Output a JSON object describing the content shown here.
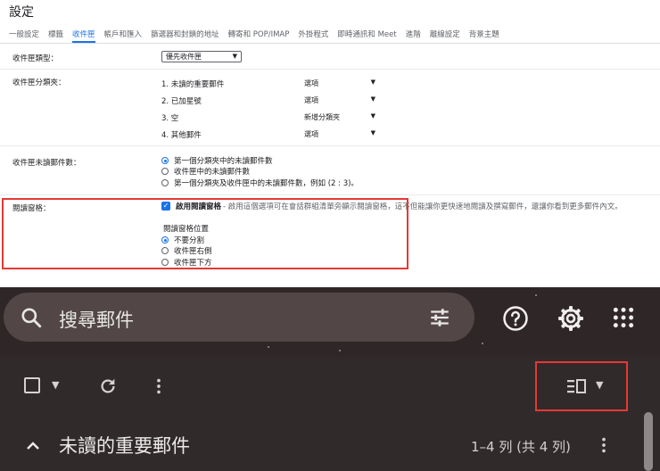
{
  "settings": {
    "title": "設定",
    "tabs": [
      {
        "label": "一般設定",
        "active": false
      },
      {
        "label": "標籤",
        "active": false
      },
      {
        "label": "收件匣",
        "active": true
      },
      {
        "label": "帳戶和匯入",
        "active": false
      },
      {
        "label": "篩選器和封鎖的地址",
        "active": false
      },
      {
        "label": "轉寄和 POP/IMAP",
        "active": false
      },
      {
        "label": "外掛程式",
        "active": false
      },
      {
        "label": "即時通訊和 Meet",
        "active": false
      },
      {
        "label": "進階",
        "active": false
      },
      {
        "label": "離線設定",
        "active": false
      },
      {
        "label": "背景主題",
        "active": false
      }
    ],
    "inbox_type": {
      "label": "收件匣類型：",
      "value": "優先收件匣"
    },
    "inbox_sections": {
      "label": "收件匣分類夾：",
      "rows": [
        {
          "name": "1. 未讀的重要郵件",
          "option": "選項"
        },
        {
          "name": "2. 已加星號",
          "option": "選項"
        },
        {
          "name": "3. 空",
          "option": "新增分類夾"
        },
        {
          "name": "4. 其他郵件",
          "option": "選項"
        }
      ]
    },
    "unread_count": {
      "label": "收件匣未讀郵件數：",
      "options": [
        {
          "text": "第一個分類夾中的未讀郵件數",
          "selected": true
        },
        {
          "text": "收件匣中的未讀郵件數",
          "selected": false
        },
        {
          "text": "第一個分類夾及收件匣中的未讀郵件數，例如 (2 : 3)。",
          "selected": false
        }
      ]
    },
    "reading_pane": {
      "label": "閱讀窗格：",
      "enable_label": "啟用閱讀窗格",
      "enable_desc": "- 啟用這個選項可在會話群組清單旁顯示閱讀窗格，這不但能讓你更快速地閱讀及撰寫郵件，還讓你看到更多郵件內文。",
      "checked": true,
      "position_heading": "閱讀窗格位置",
      "positions": [
        {
          "text": "不要分割",
          "selected": true
        },
        {
          "text": "收件匣右側",
          "selected": false
        },
        {
          "text": "收件匣下方",
          "selected": false
        }
      ]
    }
  },
  "gmail": {
    "search_placeholder": "搜尋郵件",
    "section_title": "未讀的重要郵件",
    "section_count": "1–4 列 (共 4 列)"
  },
  "colors": {
    "accent": "#1a73e8",
    "highlight": "#e53935",
    "dark_bg": "#2f2628"
  },
  "icons": [
    "search-icon",
    "tune-icon",
    "help-icon",
    "gear-icon",
    "apps-icon",
    "refresh-icon",
    "more-vert-icon",
    "split-pane-icon",
    "chevron-up-icon"
  ]
}
